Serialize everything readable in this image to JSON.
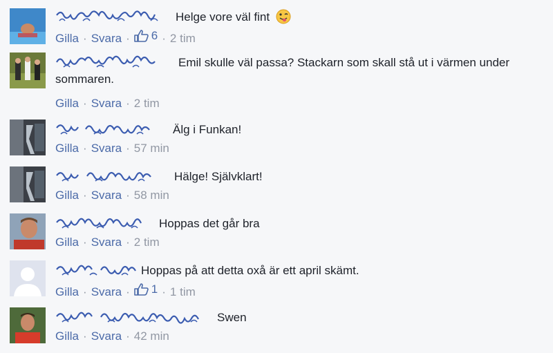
{
  "comments": [
    {
      "author": "",
      "text": "Helge vore väl fint",
      "emoji": "tongue-wink-emoji",
      "like": "Gilla",
      "reply": "Svara",
      "likes": "6",
      "time": "2 tim"
    },
    {
      "author": "",
      "text": "Emil skulle väl passa? Stackarn som skall stå ut i värmen under sommaren.",
      "like": "Gilla",
      "reply": "Svara",
      "time": "2 tim"
    },
    {
      "author": "",
      "text": "Älg i Funkan!",
      "like": "Gilla",
      "reply": "Svara",
      "time": "57 min"
    },
    {
      "author": "",
      "text": "Hälge! Självklart!",
      "like": "Gilla",
      "reply": "Svara",
      "time": "58 min"
    },
    {
      "author": "",
      "text": "Hoppas det går bra",
      "like": "Gilla",
      "reply": "Svara",
      "time": "2 tim"
    },
    {
      "author": "",
      "text": "Hoppas på att detta oxå är ett april skämt.",
      "like": "Gilla",
      "reply": "Svara",
      "likes": "1",
      "time": "1 tim"
    },
    {
      "author": "",
      "text": "Swen",
      "like": "Gilla",
      "reply": "Svara",
      "time": "42 min"
    }
  ],
  "colors": {
    "link": "#4b6aa8",
    "meta": "#9197a3",
    "background": "#f6f7f9",
    "redaction": "#3b5cb0"
  }
}
